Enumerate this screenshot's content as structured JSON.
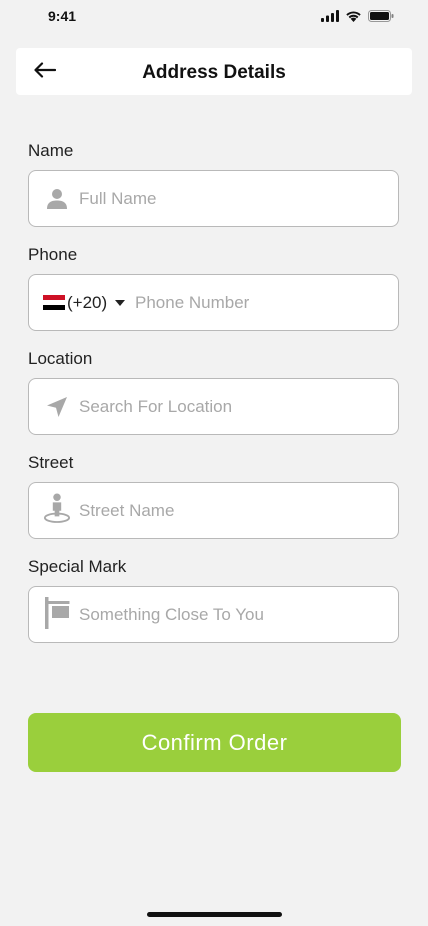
{
  "status_bar": {
    "time": "9:41",
    "icons": [
      "signal-icon",
      "wifi-icon",
      "battery-icon"
    ]
  },
  "header": {
    "title": "Address Details",
    "back_icon": "arrow-left-icon"
  },
  "form": {
    "name": {
      "label": "Name",
      "placeholder": "Full Name",
      "value": "",
      "icon": "person-icon"
    },
    "phone": {
      "label": "Phone",
      "country_flag": "egypt-flag-icon",
      "dial_code": "(+20)",
      "placeholder": "Phone Number",
      "value": ""
    },
    "location": {
      "label": "Location",
      "placeholder": "Search For Location",
      "value": "",
      "icon": "location-arrow-icon"
    },
    "street": {
      "label": "Street",
      "placeholder": "Street Name",
      "value": "",
      "icon": "street-view-icon"
    },
    "special_mark": {
      "label": "Special Mark",
      "placeholder": "Something Close To You",
      "value": "",
      "icon": "signpost-icon"
    }
  },
  "confirm_button": {
    "label": "Confirm Order"
  },
  "colors": {
    "accent": "#9acf3c",
    "background": "#f2f2f2",
    "icon_gray": "#a8a8a8",
    "border": "#b9b9b9",
    "flag_red": "#ce1126",
    "flag_white": "#ffffff",
    "flag_black": "#000000"
  }
}
